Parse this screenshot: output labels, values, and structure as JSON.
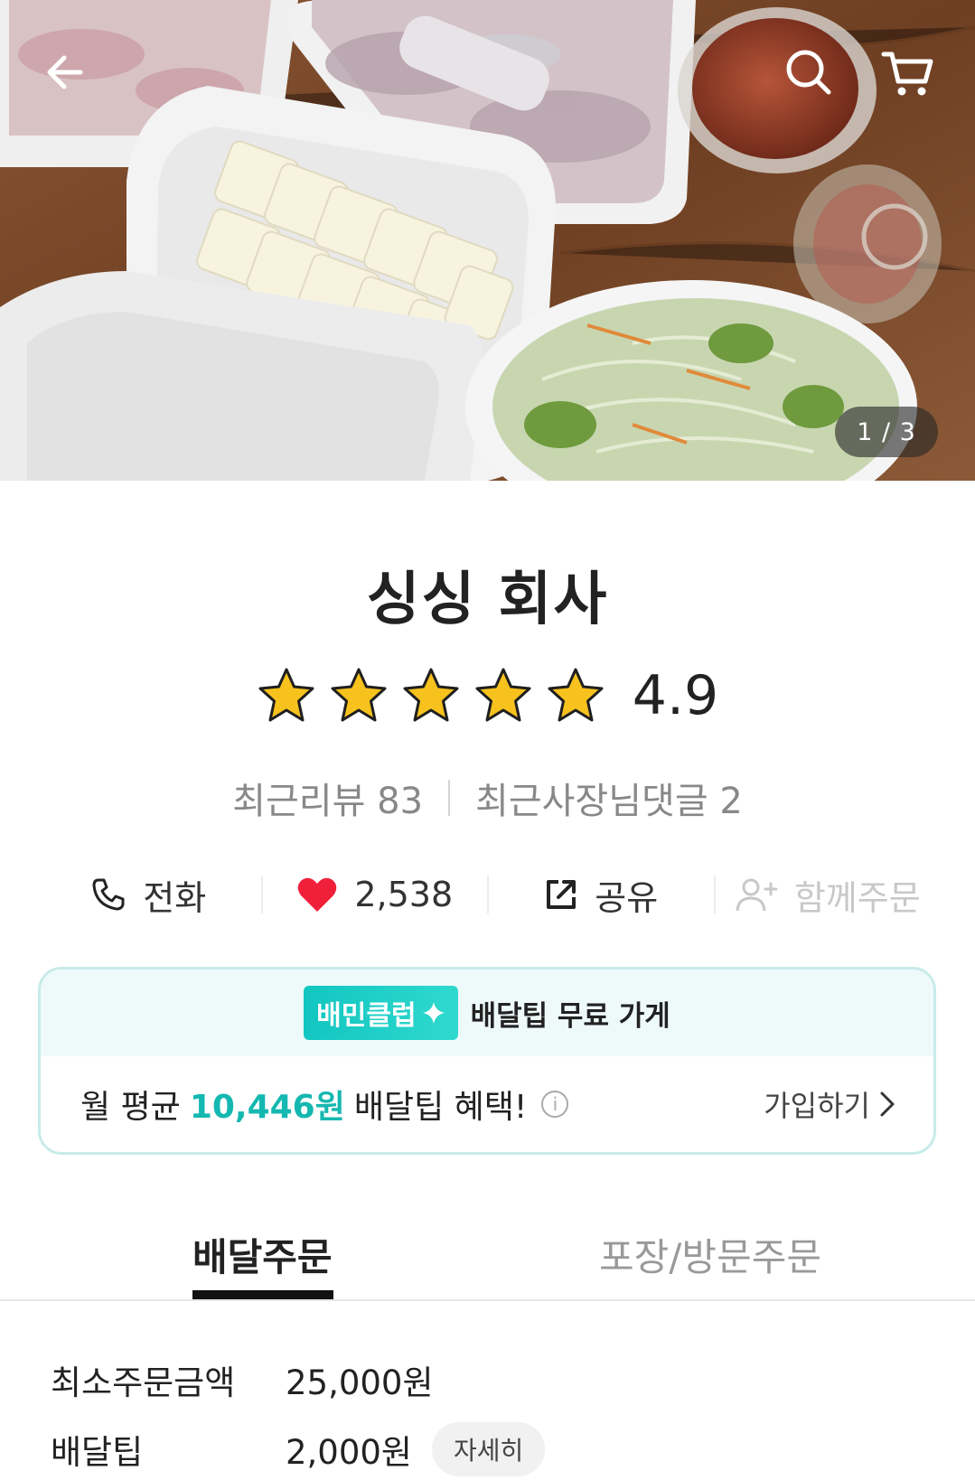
{
  "hero": {
    "counter": "1 / 3",
    "icons": [
      "back-arrow-icon",
      "search-icon",
      "cart-icon"
    ]
  },
  "store": {
    "name": "싱싱 회사",
    "rating": "4.9",
    "stars": 5,
    "recent_reviews": "최근리뷰 83",
    "recent_owner_replies": "최근사장님댓글 2"
  },
  "actions": {
    "call": "전화",
    "likes": "2,538",
    "share": "공유",
    "group_order": "함께주문"
  },
  "club": {
    "badge": "배민클럽",
    "headline": "배달팁 무료 가게",
    "benefit_prefix": "월 평균",
    "benefit_amount": "10,446원",
    "benefit_suffix": "배달팁 혜택!",
    "join": "가입하기",
    "accent": "#14b8b0"
  },
  "tabs": {
    "delivery": "배달주문",
    "pickup": "포장/방문주문"
  },
  "info": {
    "min_order_label": "최소주문금액",
    "min_order_value": "25,000원",
    "delivery_tip_label": "배달팁",
    "delivery_tip_value": "2,000원",
    "detail": "자세히"
  }
}
